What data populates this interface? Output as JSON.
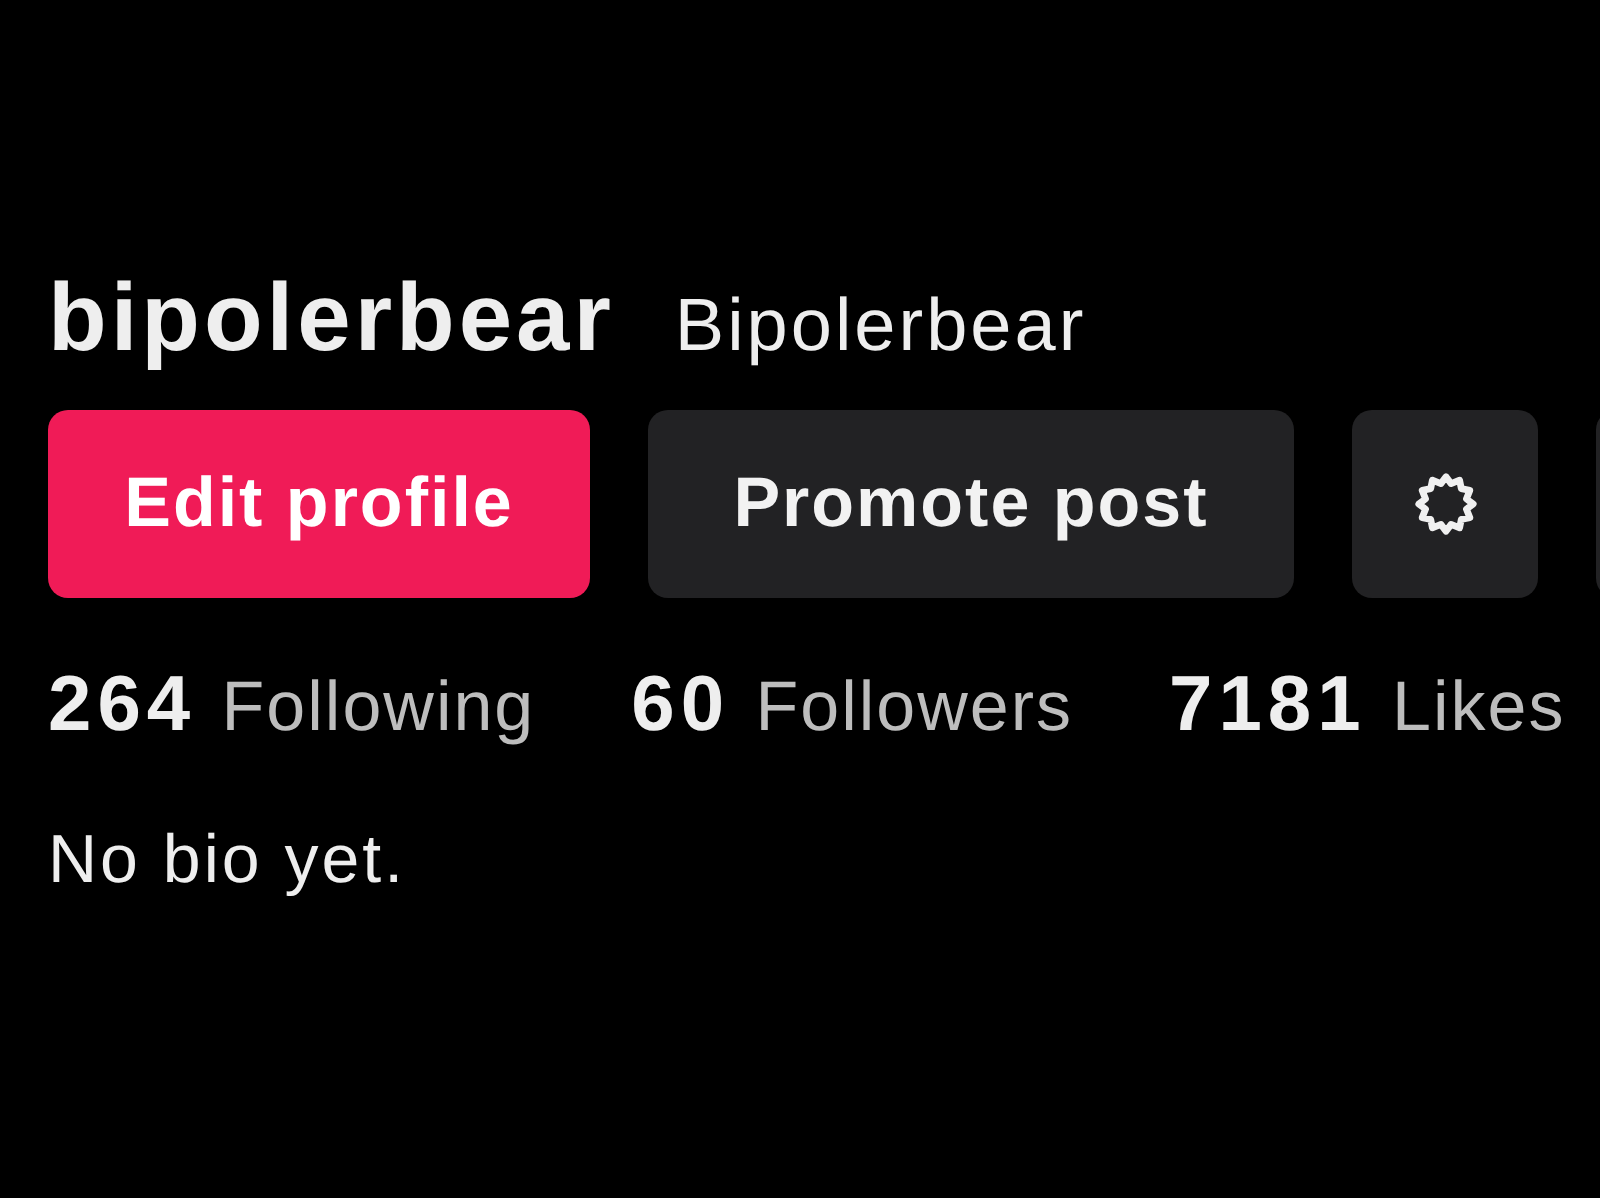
{
  "profile": {
    "username": "bipolerbear",
    "display_name": "Bipolerbear"
  },
  "buttons": [
    {
      "label": "Edit profile",
      "kind": "primary"
    },
    {
      "label": "Promote post",
      "kind": "secondary"
    },
    {
      "kind": "settings"
    }
  ],
  "stats": [
    "**264** Following",
    "**60** Followers",
    "**7181** Likes"
  ],
  "bio": "No bio yet."
}
